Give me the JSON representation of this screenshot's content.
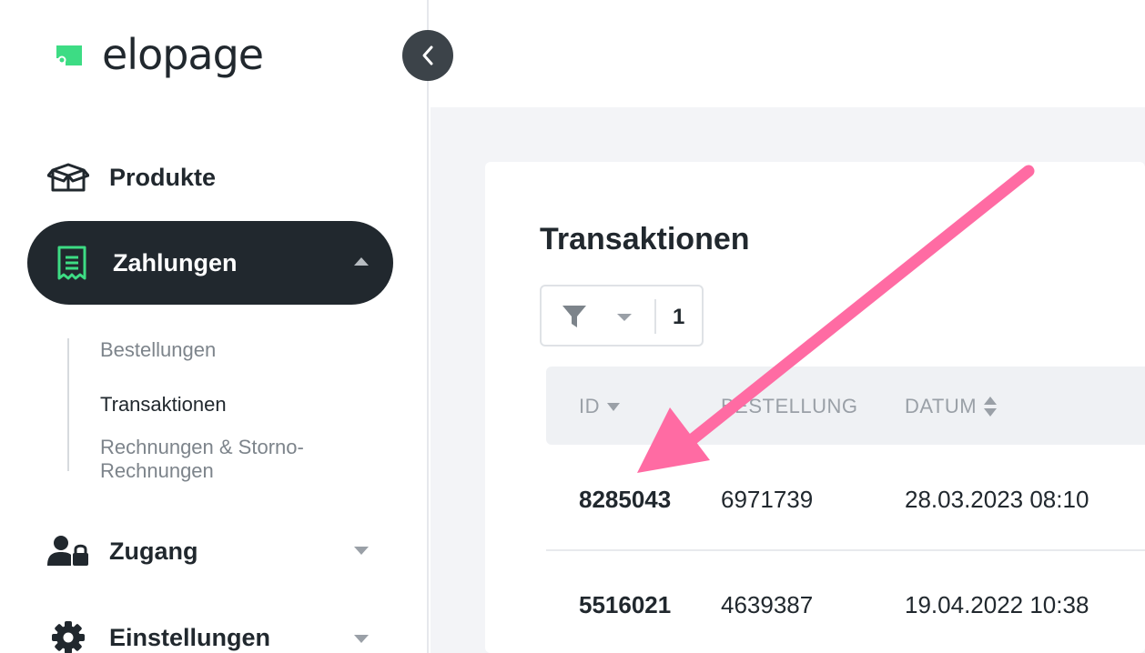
{
  "app": {
    "logo_text": "elopage",
    "brand_accent": "#3ddc84"
  },
  "sidebar": {
    "items": [
      {
        "label": "Produkte",
        "icon": "box-icon"
      },
      {
        "label": "Zahlungen",
        "icon": "receipt-icon",
        "active": true,
        "expanded": true
      },
      {
        "label": "Zugang",
        "icon": "user-lock-icon"
      },
      {
        "label": "Einstellungen",
        "icon": "gear-icon"
      }
    ],
    "subitems": [
      {
        "label": "Bestellungen"
      },
      {
        "label": "Transaktionen",
        "active": true
      },
      {
        "label_line1": "Rechnungen & Storno-",
        "label_line2": "Rechnungen"
      }
    ]
  },
  "main": {
    "title": "Transaktionen",
    "filter": {
      "count": "1"
    },
    "table": {
      "columns": [
        "ID",
        "BESTELLUNG",
        "DATUM"
      ],
      "rows": [
        {
          "id": "8285043",
          "order": "6971739",
          "date": "28.03.2023 08:10"
        },
        {
          "id": "5516021",
          "order": "4639387",
          "date": "19.04.2022 10:38"
        }
      ]
    }
  },
  "annotation": {
    "arrow_color": "#ff6ba3"
  }
}
